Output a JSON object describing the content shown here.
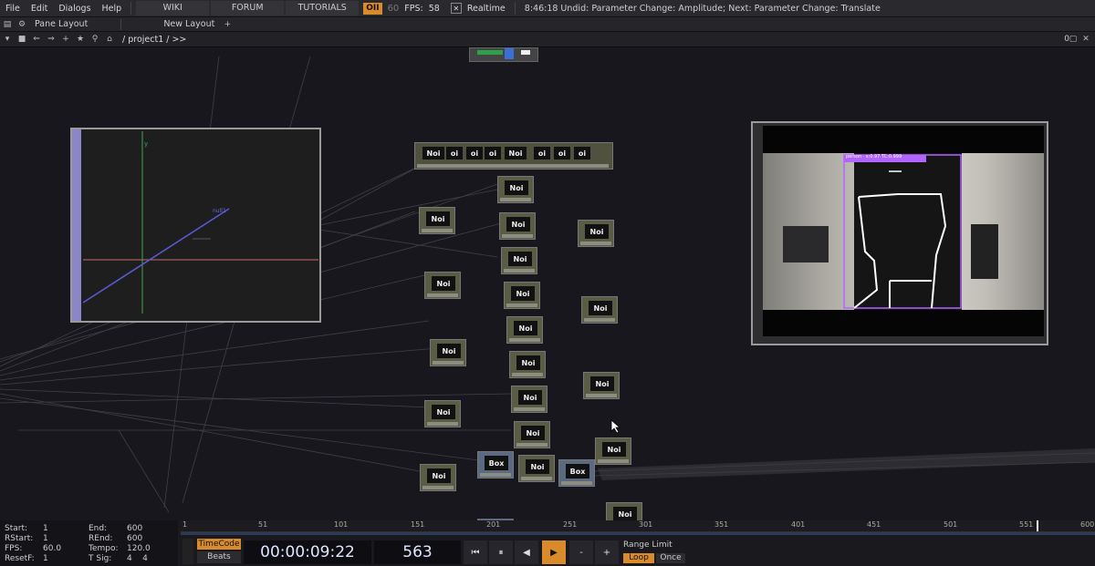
{
  "menu": {
    "items": [
      "File",
      "Edit",
      "Dialogs",
      "Help"
    ],
    "tabs": [
      "WIKI",
      "FORUM",
      "TUTORIALS"
    ],
    "oi_badge": "OII",
    "fps_small": "60",
    "fps_label": "FPS:",
    "fps_value": "58",
    "realtime_label": "Realtime",
    "realtime_checked": "✕",
    "status": "8:46:18 Undid: Parameter Change: Amplitude; Next: Parameter Change: Translate"
  },
  "panebar": {
    "pane_layout": "Pane Layout",
    "new_layout": "New Layout",
    "add_label": "+"
  },
  "pathbar": {
    "path": "/ project1 / >>",
    "right_value": "0"
  },
  "network": {
    "node_label": "Noi",
    "box_label": "Box",
    "merged_labels": [
      "Noi",
      "oi",
      "oi",
      "oi",
      "Noi",
      "oi",
      "oi",
      "oi"
    ],
    "colors": {
      "node": "#5a5c45",
      "box": "#5b6a80",
      "accent": "#8a86c8"
    }
  },
  "viewer_left": {
    "axis_label": "y",
    "legend": "null1"
  },
  "viewer_right": {
    "detect_label": "person · s:0.97 TC:0.999"
  },
  "timeline": {
    "info": [
      {
        "label": "Start:",
        "value": "1"
      },
      {
        "label": "RStart:",
        "value": "1"
      },
      {
        "label": "FPS:",
        "value": "60.0"
      },
      {
        "label": "ResetF:",
        "value": "1"
      }
    ],
    "info2": [
      {
        "label": "End:",
        "value": "600"
      },
      {
        "label": "REnd:",
        "value": "600"
      },
      {
        "label": "Tempo:",
        "value": "120.0"
      },
      {
        "label": "T Sig:",
        "value": "4    4"
      }
    ],
    "ticks": [
      "1",
      "51",
      "101",
      "151",
      "201",
      "251",
      "301",
      "351",
      "401",
      "451",
      "501",
      "551",
      "600"
    ],
    "timecode_btn": "TimeCode",
    "beats_btn": "Beats",
    "timecode": "00:00:09:22",
    "frame": "563",
    "range_limit": "Range Limit",
    "loop": "Loop",
    "once": "Once",
    "minus": "-",
    "plus": "+"
  }
}
